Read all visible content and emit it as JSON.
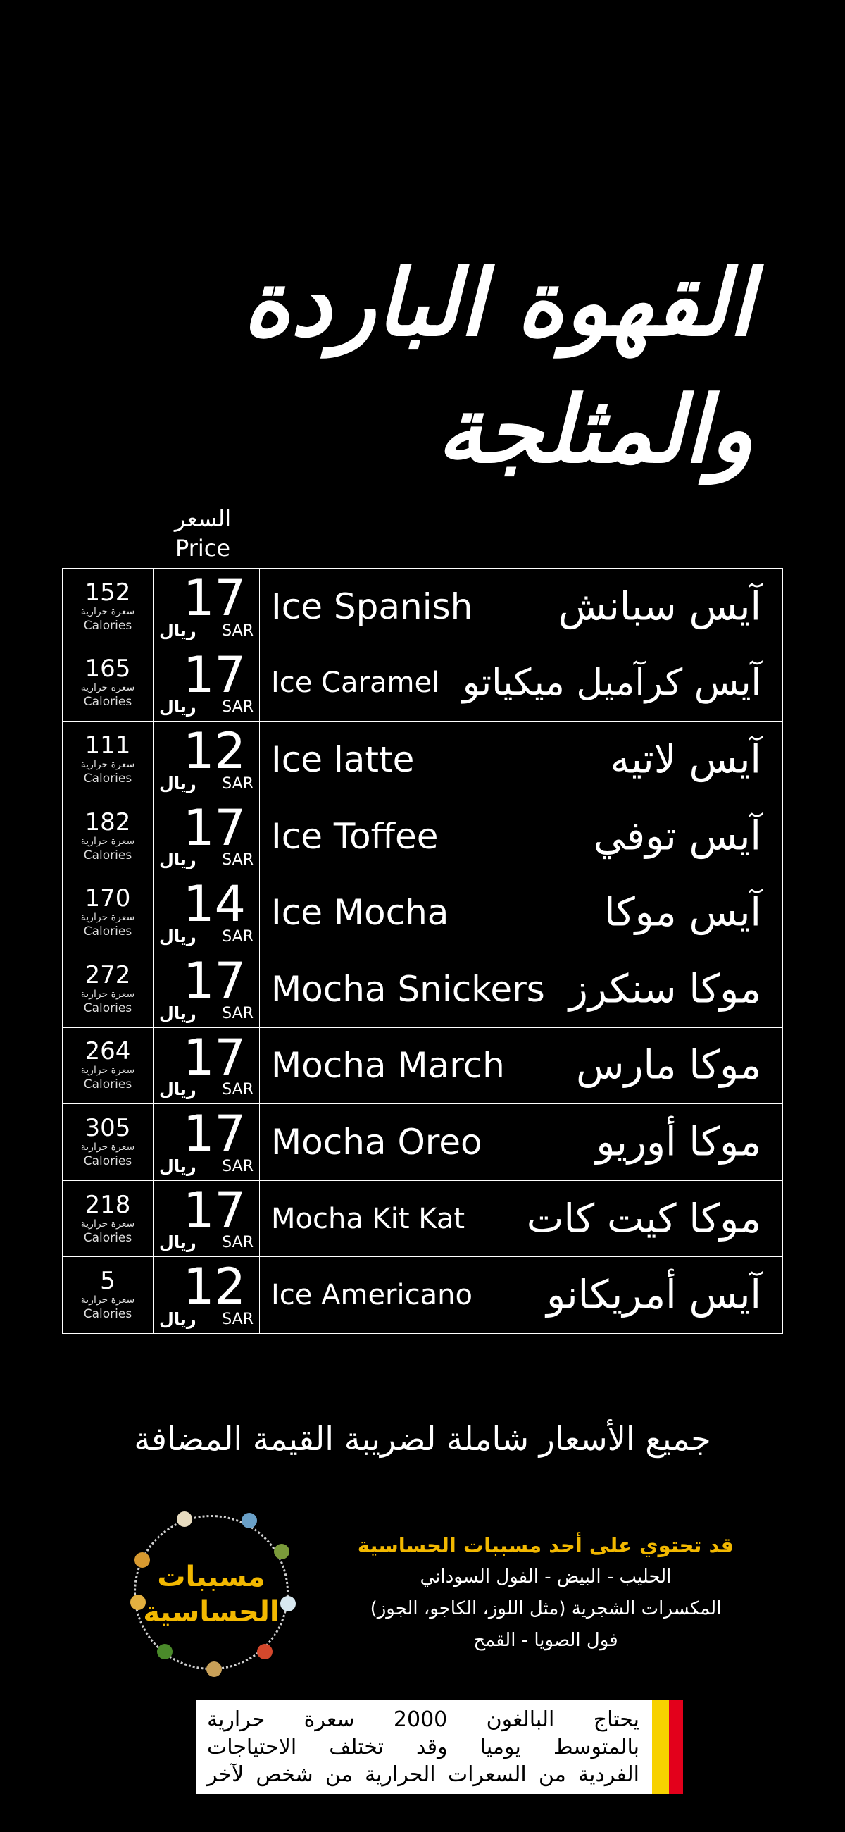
{
  "title": {
    "line1": "القهوة الباردة",
    "line2": "والمثلجة"
  },
  "price_header": {
    "ar": "السعر",
    "en": "Price"
  },
  "labels": {
    "calories_ar": "سعرة حرارية",
    "calories_en": "Calories",
    "currency_ar": "ريال",
    "currency_en": "SAR"
  },
  "items": [
    {
      "calories": "152",
      "price": "17",
      "name_en": "Ice Spanish",
      "name_ar": "آيس سبانش"
    },
    {
      "calories": "165",
      "price": "17",
      "name_en": "Ice Caramel",
      "name_ar": "آيس كرآميل ميكياتو"
    },
    {
      "calories": "111",
      "price": "12",
      "name_en": "Ice latte",
      "name_ar": "آيس لاتيه"
    },
    {
      "calories": "182",
      "price": "17",
      "name_en": "Ice Toffee",
      "name_ar": "آيس توفي"
    },
    {
      "calories": "170",
      "price": "14",
      "name_en": "Ice Mocha",
      "name_ar": "آيس موكا"
    },
    {
      "calories": "272",
      "price": "17",
      "name_en": "Mocha Snickers",
      "name_ar": "موكا سنكرز"
    },
    {
      "calories": "264",
      "price": "17",
      "name_en": "Mocha March",
      "name_ar": "موكا مارس"
    },
    {
      "calories": "305",
      "price": "17",
      "name_en": "Mocha Oreo",
      "name_ar": "موكا أوريو"
    },
    {
      "calories": "218",
      "price": "17",
      "name_en": "Mocha Kit Kat",
      "name_ar": "موكا كيت كات"
    },
    {
      "calories": "5",
      "price": "12",
      "name_en": "Ice Americano",
      "name_ar": "آيس أمريكانو"
    }
  ],
  "vat_note": "جميع الأسعار شاملة لضريبة القيمة المضافة",
  "allergens_badge": {
    "line1": "مسببات",
    "line2": "الحساسية"
  },
  "allergens": {
    "heading": "قد تحتوي على أحد مسببات الحساسية",
    "lines": [
      "الحليب - البيض - الفول السوداني",
      "المكسرات الشجرية (مثل اللوز، الكاجو، الجوز)",
      "فول الصويا - القمح"
    ]
  },
  "calorie_note": {
    "lines": [
      "يحتاج البالغون 2000 سعرة حرارية",
      "بالمتوسط يوميا وقد تختلف الاحتياجات",
      "الفردية من السعرات الحرارية من شخص لآخر"
    ]
  },
  "colors": {
    "background": "#000000",
    "accent": "#f2b800",
    "flag_red": "#e3001b",
    "flag_yellow": "#f7d100"
  }
}
